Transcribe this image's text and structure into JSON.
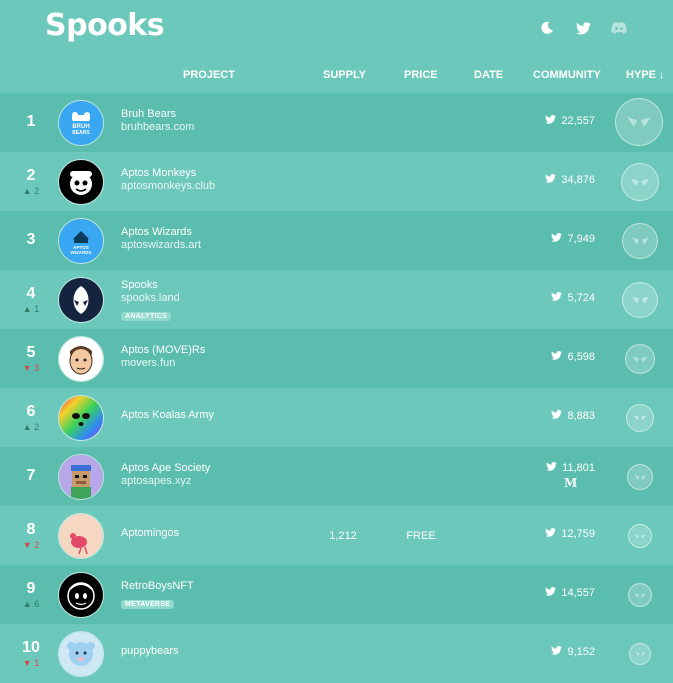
{
  "app": {
    "title": "Spooks"
  },
  "top_icons": [
    "moon-icon",
    "twitter-icon",
    "discord-icon"
  ],
  "columns": {
    "project": "PROJECT",
    "supply": "SUPPLY",
    "price": "PRICE",
    "date": "DATE",
    "community": "COMMUNITY",
    "hype": "HYPE ↓"
  },
  "rows": [
    {
      "rank": "1",
      "change": "",
      "name": "Bruh Bears",
      "url": "bruhbears.com",
      "tag": "",
      "supply": "",
      "price": "",
      "followers": "22,557",
      "medium": ""
    },
    {
      "rank": "2",
      "change": "▲ 2",
      "name": "Aptos Monkeys",
      "url": "aptosmonkeys.club",
      "tag": "",
      "supply": "",
      "price": "",
      "followers": "34,876",
      "medium": ""
    },
    {
      "rank": "3",
      "change": "",
      "name": "Aptos Wizards",
      "url": "aptoswizards.art",
      "tag": "",
      "supply": "",
      "price": "",
      "followers": "7,949",
      "medium": ""
    },
    {
      "rank": "4",
      "change": "▲ 1",
      "name": "Spooks",
      "url": "spooks.land",
      "tag": "ANALYTICS",
      "supply": "",
      "price": "",
      "followers": "5,724",
      "medium": ""
    },
    {
      "rank": "5",
      "change": "▼ 3",
      "name": "Aptos (MOVE)Rs",
      "url": "movers.fun",
      "tag": "",
      "supply": "",
      "price": "",
      "followers": "6,598",
      "medium": ""
    },
    {
      "rank": "6",
      "change": "▲ 2",
      "name": "Aptos Koalas Army",
      "url": "",
      "tag": "",
      "supply": "",
      "price": "",
      "followers": "8,883",
      "medium": ""
    },
    {
      "rank": "7",
      "change": "",
      "name": "Aptos Ape Society",
      "url": "aptosapes.xyz",
      "tag": "",
      "supply": "",
      "price": "",
      "followers": "11,801",
      "medium": "M"
    },
    {
      "rank": "8",
      "change": "▼ 2",
      "name": "Aptomingos",
      "url": "",
      "tag": "",
      "supply": "1,212",
      "price": "FREE",
      "followers": "12,759",
      "medium": ""
    },
    {
      "rank": "9",
      "change": "▲ 6",
      "name": "RetroBoysNFT",
      "url": "",
      "tag": "METAVERSE",
      "supply": "",
      "price": "",
      "followers": "14,557",
      "medium": ""
    },
    {
      "rank": "10",
      "change": "▼ 1",
      "name": "puppybears",
      "url": "",
      "tag": "",
      "supply": "",
      "price": "",
      "followers": "9,152",
      "medium": ""
    }
  ],
  "avatar_texts": {
    "bruh_line1": "BRUH",
    "bruh_line2": "BEARS",
    "wiz_line1": "APTOS",
    "wiz_line2": "WIZARDS"
  }
}
